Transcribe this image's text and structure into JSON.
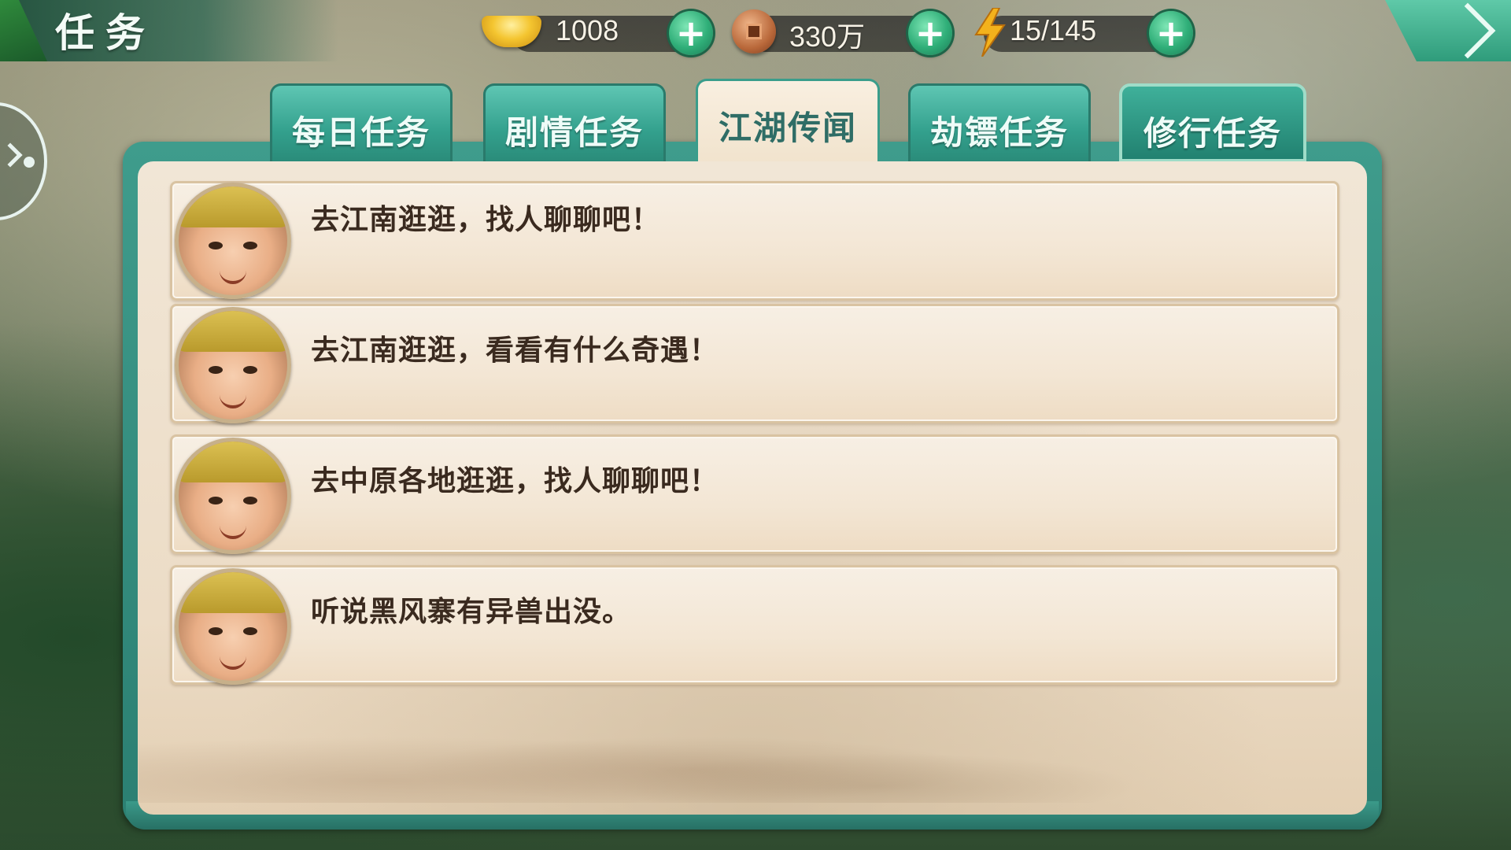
{
  "header": {
    "title": "任务"
  },
  "resources": [
    {
      "icon": "gold-ingot-icon",
      "value": "1008"
    },
    {
      "icon": "copper-coin-icon",
      "value": "330万"
    },
    {
      "icon": "lightning-icon",
      "value": "15/145"
    }
  ],
  "tabs": [
    {
      "label": "每日任务",
      "active": false
    },
    {
      "label": "剧情任务",
      "active": false
    },
    {
      "label": "江湖传闻",
      "active": true
    },
    {
      "label": "劫镖任务",
      "active": false
    },
    {
      "label": "修行任务",
      "active": false
    }
  ],
  "tasks": [
    {
      "text": "去江南逛逛，找人聊聊吧！"
    },
    {
      "text": "去江南逛逛，看看有什么奇遇！"
    },
    {
      "text": "去中原各地逛逛，找人聊聊吧！"
    },
    {
      "text": "听说黑风寨有异兽出没。"
    }
  ],
  "colors": {
    "accent": "#33a08d",
    "panel": "#f1e6d6",
    "task_text": "#3a2a1f"
  }
}
